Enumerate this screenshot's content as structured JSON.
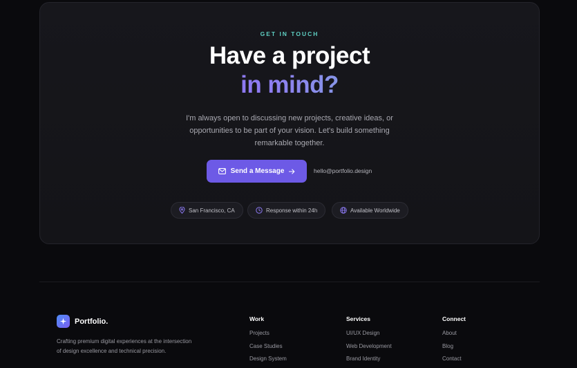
{
  "cta": {
    "eyebrow": "GET IN TOUCH",
    "headline_line1": "Have a project",
    "headline_line2": "in mind?",
    "intro": "I'm always open to discussing new projects, creative ideas, or opportunities to be part of your vision. Let's build something remarkable together.",
    "send_button": "Send a Message",
    "email": "hello@portfolio.design",
    "chips": [
      {
        "icon": "map-pin-icon",
        "label": "San Francisco, CA"
      },
      {
        "icon": "clock-icon",
        "label": "Response within 24h"
      },
      {
        "icon": "globe-icon",
        "label": "Available Worldwide"
      }
    ]
  },
  "footer": {
    "brand_name": "Portfolio.",
    "brand_description": "Crafting premium digital experiences at the intersection of design excellence and technical precision.",
    "columns": [
      {
        "title": "Work",
        "links": [
          "Projects",
          "Case Studies",
          "Design System"
        ]
      },
      {
        "title": "Services",
        "links": [
          "UI/UX Design",
          "Web Development",
          "Brand Identity"
        ]
      },
      {
        "title": "Connect",
        "links": [
          "About",
          "Blog",
          "Contact"
        ]
      }
    ]
  },
  "colors": {
    "accent": "#6d5ae6",
    "eyebrow": "#5fd0c4",
    "background": "#0a0a0d",
    "card": "#17171c"
  }
}
